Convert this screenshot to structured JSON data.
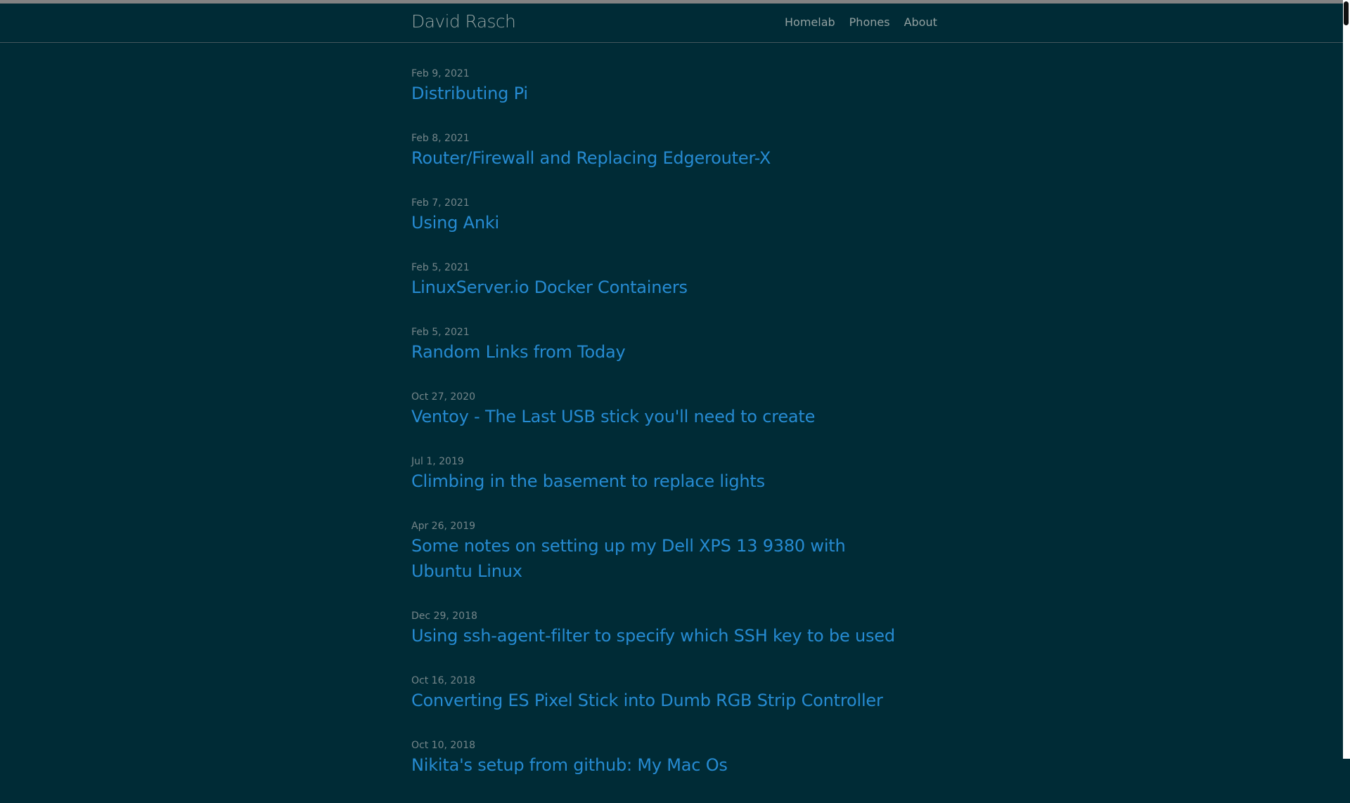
{
  "header": {
    "site_title": "David Rasch",
    "nav": [
      {
        "label": "Homelab"
      },
      {
        "label": "Phones"
      },
      {
        "label": "About"
      }
    ]
  },
  "posts": [
    {
      "date": "Feb 9, 2021",
      "title": "Distributing Pi"
    },
    {
      "date": "Feb 8, 2021",
      "title": "Router/Firewall and Replacing Edgerouter-X"
    },
    {
      "date": "Feb 7, 2021",
      "title": "Using Anki"
    },
    {
      "date": "Feb 5, 2021",
      "title": "LinuxServer.io Docker Containers"
    },
    {
      "date": "Feb 5, 2021",
      "title": "Random Links from Today"
    },
    {
      "date": "Oct 27, 2020",
      "title": "Ventoy - The Last USB stick you'll need to create"
    },
    {
      "date": "Jul 1, 2019",
      "title": "Climbing in the basement to replace lights"
    },
    {
      "date": "Apr 26, 2019",
      "title": "Some notes on setting up my Dell XPS 13 9380 with Ubuntu Linux"
    },
    {
      "date": "Dec 29, 2018",
      "title": "Using ssh-agent-filter to specify which SSH key to be used"
    },
    {
      "date": "Oct 16, 2018",
      "title": "Converting ES Pixel Stick into Dumb RGB Strip Controller"
    },
    {
      "date": "Oct 10, 2018",
      "title": "Nikita's setup from github: My Mac Os"
    }
  ],
  "colors": {
    "background": "#002b36",
    "link": "#268bd2",
    "muted_text": "#93a1a1",
    "date_text": "#75868a"
  }
}
